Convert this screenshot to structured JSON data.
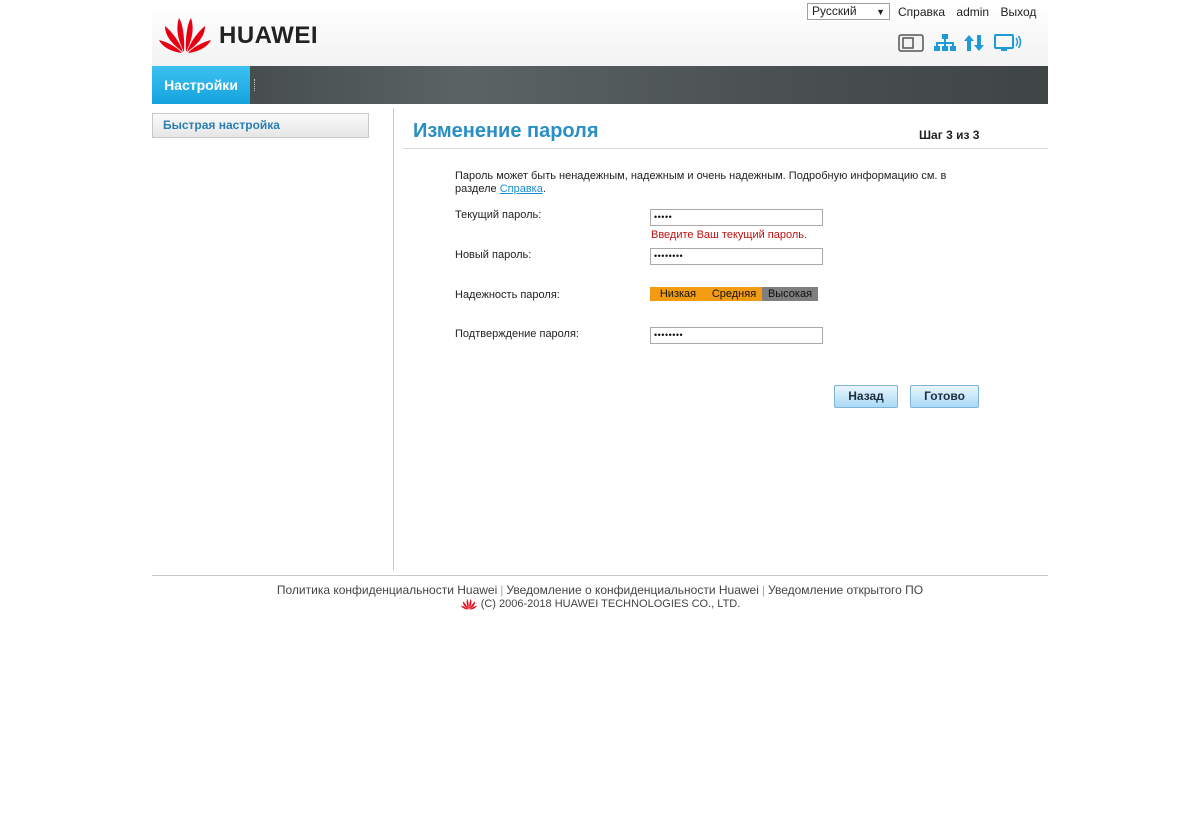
{
  "header": {
    "brand": "HUAWEI",
    "language": "Русский",
    "links": {
      "help": "Справка",
      "user": "admin",
      "logout": "Выход"
    },
    "status_icons": [
      "sim-card-icon",
      "network-icon",
      "data-transfer-icon",
      "wifi-display-icon"
    ]
  },
  "nav": {
    "tab_settings": "Настройки"
  },
  "sidebar": {
    "items": [
      {
        "label": "Быстрая настройка"
      }
    ]
  },
  "main": {
    "title": "Изменение пароля",
    "step": "Шаг 3 из 3",
    "description": "Пароль может быть ненадежным, надежным и очень надежным. Подробную информацию см. в разделе ",
    "description_link": "Справка",
    "description_end": ".",
    "fields": {
      "current_password": {
        "label": "Текущий пароль:",
        "value": "•••••"
      },
      "current_password_error": "Введите Ваш текущий пароль.",
      "new_password": {
        "label": "Новый пароль:",
        "value": "••••••••"
      },
      "strength": {
        "label": "Надежность пароля:",
        "levels": [
          "Низкая",
          "Средняя",
          "Высокая"
        ],
        "active_level": 2
      },
      "confirm_password": {
        "label": "Подтверждение пароля:",
        "value": "••••••••"
      }
    },
    "buttons": {
      "back": "Назад",
      "done": "Готово"
    }
  },
  "footer": {
    "links": [
      "Политика конфиденциальности Huawei",
      "Уведомление о конфиденциальности Huawei",
      "Уведомление открытого ПО"
    ],
    "copyright": "(C) 2006-2018 HUAWEI TECHNOLOGIES CO., LTD."
  },
  "colors": {
    "accent": "#14a3de",
    "title": "#2a8fc4",
    "error": "#c01010",
    "strength_active": "#f39c12",
    "brand_red": "#e60012"
  }
}
